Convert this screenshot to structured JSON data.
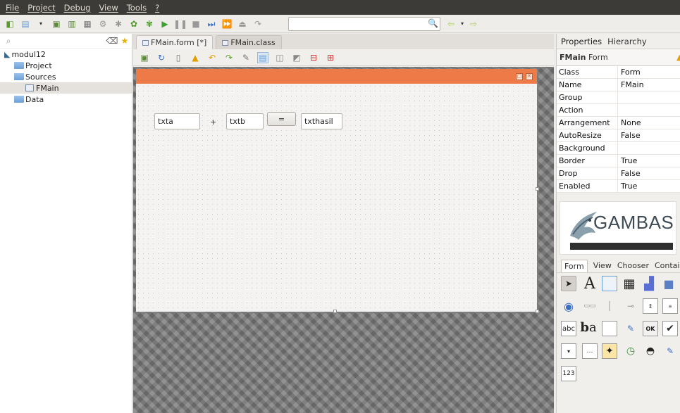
{
  "menu": [
    "File",
    "Project",
    "Debug",
    "View",
    "Tools",
    "?"
  ],
  "project_tree": {
    "root": "modul12",
    "items": [
      {
        "label": "Project",
        "indent": 1
      },
      {
        "label": "Sources",
        "indent": 1
      },
      {
        "label": "FMain",
        "indent": 2,
        "selected": true
      },
      {
        "label": "Data",
        "indent": 1
      }
    ]
  },
  "editor_tabs": [
    {
      "label": "FMain.form [*]",
      "active": true
    },
    {
      "label": "FMain.class",
      "active": false
    }
  ],
  "form": {
    "controls": {
      "txta": "txta",
      "plus": "+",
      "txtb": "txtb",
      "equals": "=",
      "txthasil": "txthasil"
    }
  },
  "properties": {
    "tabs": [
      "Properties",
      "Hierarchy"
    ],
    "object_name": "FMain",
    "object_type": "Form",
    "rows": [
      {
        "key": "Class",
        "value": "Form"
      },
      {
        "key": "Name",
        "value": "FMain"
      },
      {
        "key": "Group",
        "value": ""
      },
      {
        "key": "Action",
        "value": ""
      },
      {
        "key": "Arrangement",
        "value": "None"
      },
      {
        "key": "AutoResize",
        "value": "False"
      },
      {
        "key": "Background",
        "value": ""
      },
      {
        "key": "Border",
        "value": "True"
      },
      {
        "key": "Drop",
        "value": "False"
      },
      {
        "key": "Enabled",
        "value": "True"
      }
    ]
  },
  "logo": {
    "text": "GAMBAS"
  },
  "toolbox": {
    "tabs": [
      "Form",
      "View",
      "Chooser",
      "Containe"
    ],
    "ok_label": "OK",
    "abc_label": "abc",
    "num_label": "123"
  },
  "colors": {
    "form_title": "#ee7a47",
    "menubar": "#3c3b37"
  }
}
